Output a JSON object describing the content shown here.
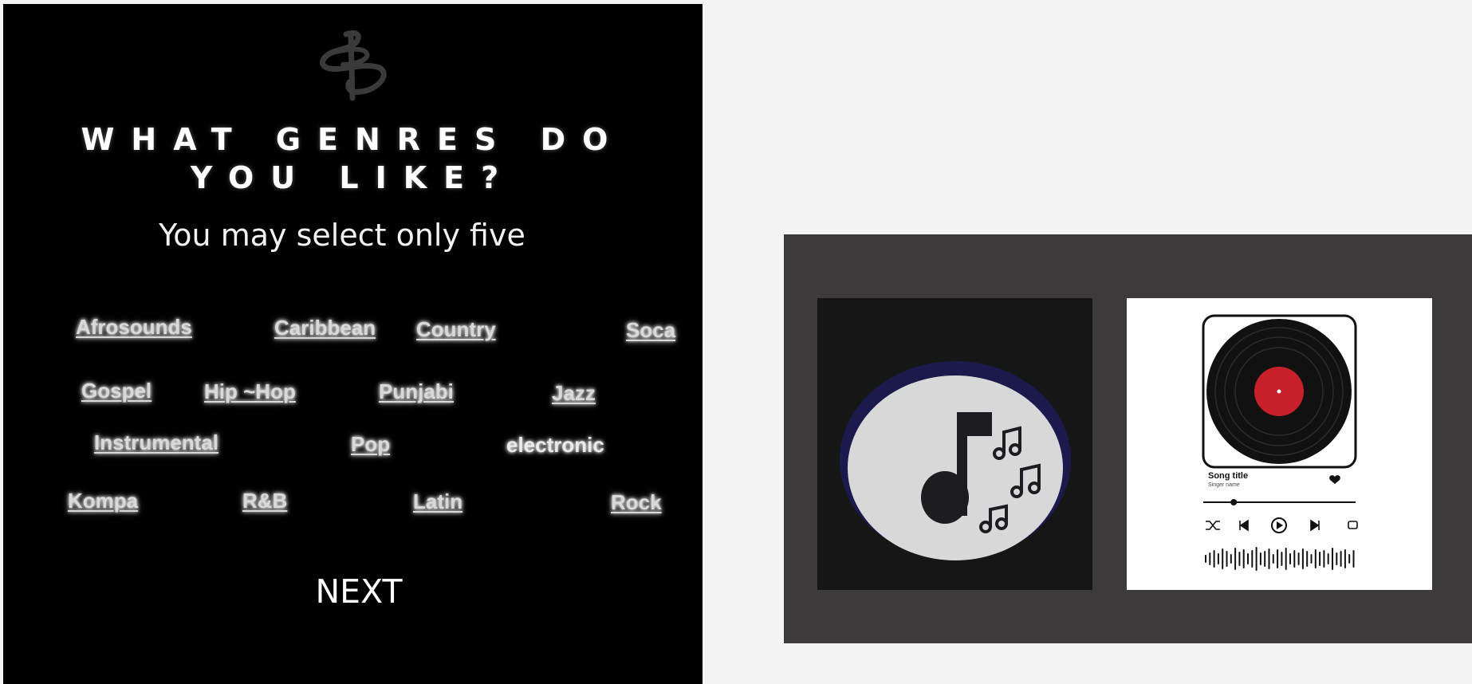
{
  "onboarding": {
    "logo_icon": "b-monogram-logo",
    "question": "WHAT GENRES DO YOU LIKE?",
    "subtitle": "You may select only five",
    "genres": [
      {
        "label": "Afrosounds"
      },
      {
        "label": "Caribbean"
      },
      {
        "label": "Country"
      },
      {
        "label": "Soca"
      },
      {
        "label": "Gospel"
      },
      {
        "label": "Hip ~Hop"
      },
      {
        "label": "Punjabi"
      },
      {
        "label": "Jazz"
      },
      {
        "label": "Instrumental"
      },
      {
        "label": "Pop"
      },
      {
        "label": "electronic"
      },
      {
        "label": "Kompa"
      },
      {
        "label": "R&B"
      },
      {
        "label": "Latin"
      },
      {
        "label": "Rock"
      }
    ],
    "next_label": "NEXT"
  },
  "preview": {
    "music_icon": "music-notes-icon",
    "player": {
      "song_title": "Song title",
      "singer_name": "Singer name",
      "progress": 0.2,
      "controls": [
        "shuffle-icon",
        "previous-icon",
        "play-icon",
        "next-icon",
        "repeat-icon"
      ],
      "colors": {
        "record_label": "#c8202a",
        "record": "#111111"
      }
    }
  }
}
